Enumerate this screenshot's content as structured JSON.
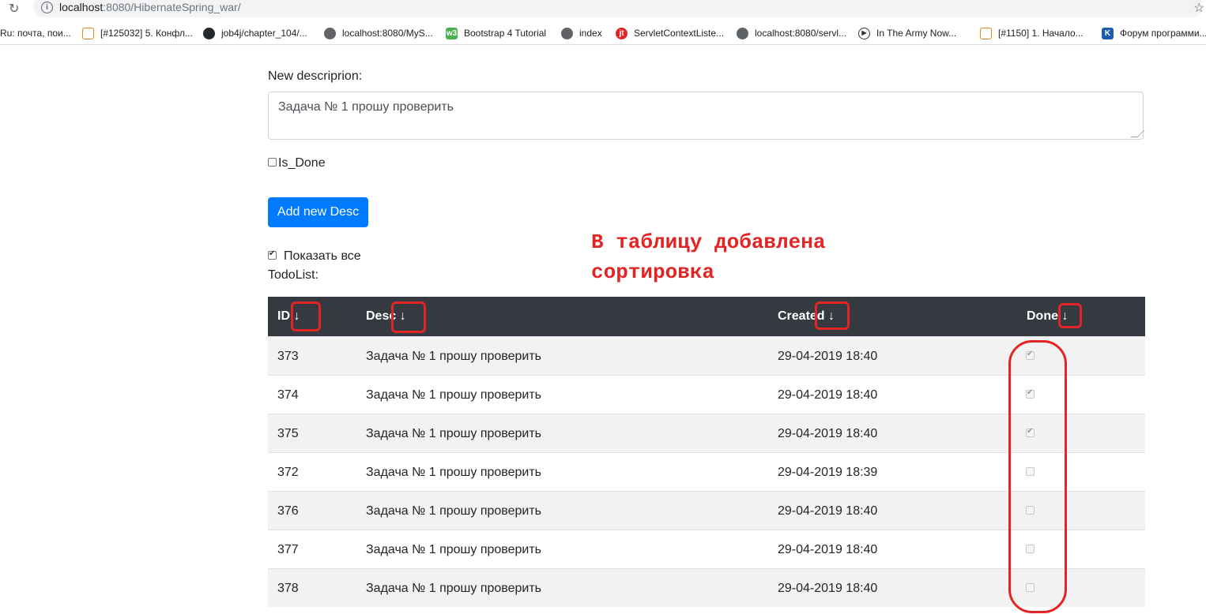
{
  "browser": {
    "url_host": "localhost",
    "url_rest": ":8080/HibernateSpring_war/",
    "bookmarks": [
      {
        "label": "Ru: почта, пои...",
        "icon": "mail-ru-icon",
        "color": "#ffffff"
      },
      {
        "label": "[#125032] 5. Конфл...",
        "icon": "task-icon",
        "color": "#f58220"
      },
      {
        "label": "job4j/chapter_104/...",
        "icon": "github-icon",
        "color": "#24292e"
      },
      {
        "label": "localhost:8080/MyS...",
        "icon": "globe-icon",
        "color": "#5f6368"
      },
      {
        "label": "Bootstrap 4 Tutorial",
        "icon": "w3-icon",
        "color": "#4caf50"
      },
      {
        "label": "index",
        "icon": "globe-icon",
        "color": "#5f6368"
      },
      {
        "label": "ServletContextListe...",
        "icon": "javatpoint-icon",
        "color": "#e22424"
      },
      {
        "label": "localhost:8080/servl...",
        "icon": "globe-icon",
        "color": "#5f6368"
      },
      {
        "label": "In The Army Now...",
        "icon": "video-icon",
        "color": "#ffffff"
      },
      {
        "label": "[#1150] 1. Начало...",
        "icon": "task-icon",
        "color": "#f58220"
      },
      {
        "label": "Форум программи...",
        "icon": "cyberforum-icon",
        "color": "#1e5ba8"
      }
    ]
  },
  "form": {
    "desc_label": "New descriprion:",
    "desc_value": "Задача № 1 прошу проверить",
    "isdone_label": "Is_Done",
    "isdone_checked": false,
    "submit_label": "Add new Desc",
    "show_all_label": "Показать все",
    "show_all_checked": true,
    "list_title": "TodoList:"
  },
  "annotation": {
    "line1": "В таблицу добавлена",
    "line2": "сортировка",
    "color": "#e22424"
  },
  "table": {
    "headers": [
      {
        "label": "ID",
        "sort": "↓"
      },
      {
        "label": "Desc",
        "sort": "↓"
      },
      {
        "label": "Created",
        "sort": "↓"
      },
      {
        "label": "Done",
        "sort": "↓"
      }
    ],
    "rows": [
      {
        "id": "373",
        "desc": "Задача № 1 прошу проверить",
        "created": "29-04-2019 18:40",
        "done": true
      },
      {
        "id": "374",
        "desc": "Задача № 1 прошу проверить",
        "created": "29-04-2019 18:40",
        "done": true
      },
      {
        "id": "375",
        "desc": "Задача № 1 прошу проверить",
        "created": "29-04-2019 18:40",
        "done": true
      },
      {
        "id": "372",
        "desc": "Задача № 1 прошу проверить",
        "created": "29-04-2019 18:39",
        "done": false
      },
      {
        "id": "376",
        "desc": "Задача № 1 прошу проверить",
        "created": "29-04-2019 18:40",
        "done": false
      },
      {
        "id": "377",
        "desc": "Задача № 1 прошу проверить",
        "created": "29-04-2019 18:40",
        "done": false
      },
      {
        "id": "378",
        "desc": "Задача № 1 прошу проверить",
        "created": "29-04-2019 18:40",
        "done": false
      }
    ]
  }
}
